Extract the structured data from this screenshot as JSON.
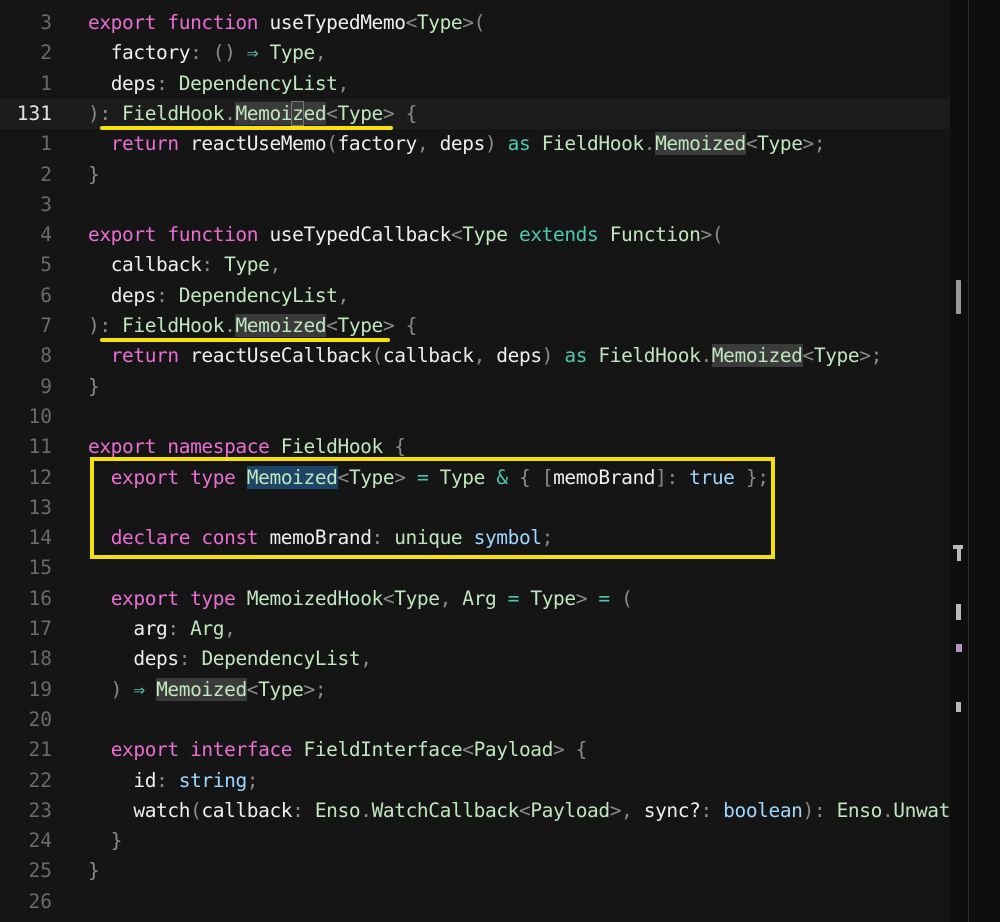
{
  "editor": {
    "lines": [
      {
        "n": "3",
        "tokens": [
          [
            "k",
            "export"
          ],
          [
            "v",
            " "
          ],
          [
            "k",
            "function"
          ],
          [
            "v",
            " "
          ],
          [
            "f",
            "useTypedMemo"
          ],
          [
            "p",
            "<"
          ],
          [
            "t",
            "Type"
          ],
          [
            "p",
            ">("
          ]
        ]
      },
      {
        "n": "2",
        "tokens": [
          [
            "v",
            "  "
          ],
          [
            "v",
            "factory"
          ],
          [
            "p",
            ": () "
          ],
          [
            "b",
            "⇒"
          ],
          [
            "v",
            " "
          ],
          [
            "t",
            "Type"
          ],
          [
            "p",
            ","
          ]
        ]
      },
      {
        "n": "1",
        "tokens": [
          [
            "v",
            "  "
          ],
          [
            "v",
            "deps"
          ],
          [
            "p",
            ": "
          ],
          [
            "t",
            "DependencyList"
          ],
          [
            "p",
            ","
          ]
        ]
      },
      {
        "n": "131",
        "current": true,
        "tokens": [
          [
            "p",
            "): "
          ],
          [
            "t",
            "FieldHook"
          ],
          [
            "p",
            "."
          ],
          [
            "hl",
            "Memoi"
          ],
          [
            "cur",
            "z"
          ],
          [
            "hl",
            "ed"
          ],
          [
            "p",
            "<"
          ],
          [
            "t",
            "Type"
          ],
          [
            "p",
            "> {"
          ]
        ]
      },
      {
        "n": "1",
        "tokens": [
          [
            "v",
            "  "
          ],
          [
            "k",
            "return"
          ],
          [
            "v",
            " "
          ],
          [
            "f",
            "reactUseMemo"
          ],
          [
            "p",
            "("
          ],
          [
            "v",
            "factory"
          ],
          [
            "p",
            ", "
          ],
          [
            "v",
            "deps"
          ],
          [
            "p",
            ") "
          ],
          [
            "b",
            "as"
          ],
          [
            "v",
            " "
          ],
          [
            "t",
            "FieldHook"
          ],
          [
            "p",
            "."
          ],
          [
            "hl",
            "Memoized"
          ],
          [
            "p",
            "<"
          ],
          [
            "t",
            "Type"
          ],
          [
            "p",
            ">;"
          ]
        ]
      },
      {
        "n": "2",
        "tokens": [
          [
            "p",
            "}"
          ]
        ]
      },
      {
        "n": "3",
        "tokens": []
      },
      {
        "n": "4",
        "tokens": [
          [
            "k",
            "export"
          ],
          [
            "v",
            " "
          ],
          [
            "k",
            "function"
          ],
          [
            "v",
            " "
          ],
          [
            "f",
            "useTypedCallback"
          ],
          [
            "p",
            "<"
          ],
          [
            "t",
            "Type"
          ],
          [
            "v",
            " "
          ],
          [
            "b",
            "extends"
          ],
          [
            "v",
            " "
          ],
          [
            "t",
            "Function"
          ],
          [
            "p",
            ">("
          ]
        ]
      },
      {
        "n": "5",
        "tokens": [
          [
            "v",
            "  "
          ],
          [
            "v",
            "callback"
          ],
          [
            "p",
            ": "
          ],
          [
            "t",
            "Type"
          ],
          [
            "p",
            ","
          ]
        ]
      },
      {
        "n": "6",
        "tokens": [
          [
            "v",
            "  "
          ],
          [
            "v",
            "deps"
          ],
          [
            "p",
            ": "
          ],
          [
            "t",
            "DependencyList"
          ],
          [
            "p",
            ","
          ]
        ]
      },
      {
        "n": "7",
        "tokens": [
          [
            "p",
            "): "
          ],
          [
            "t",
            "FieldHook"
          ],
          [
            "p",
            "."
          ],
          [
            "hl",
            "Memoized"
          ],
          [
            "p",
            "<"
          ],
          [
            "t",
            "Type"
          ],
          [
            "p",
            "> {"
          ]
        ]
      },
      {
        "n": "8",
        "tokens": [
          [
            "v",
            "  "
          ],
          [
            "k",
            "return"
          ],
          [
            "v",
            " "
          ],
          [
            "f",
            "reactUseCallback"
          ],
          [
            "p",
            "("
          ],
          [
            "v",
            "callback"
          ],
          [
            "p",
            ", "
          ],
          [
            "v",
            "deps"
          ],
          [
            "p",
            ") "
          ],
          [
            "b",
            "as"
          ],
          [
            "v",
            " "
          ],
          [
            "t",
            "FieldHook"
          ],
          [
            "p",
            "."
          ],
          [
            "hl",
            "Memoized"
          ],
          [
            "p",
            "<"
          ],
          [
            "t",
            "Type"
          ],
          [
            "p",
            ">;"
          ]
        ]
      },
      {
        "n": "9",
        "tokens": [
          [
            "p",
            "}"
          ]
        ]
      },
      {
        "n": "10",
        "tokens": []
      },
      {
        "n": "11",
        "tokens": [
          [
            "k",
            "export"
          ],
          [
            "v",
            " "
          ],
          [
            "k",
            "namespace"
          ],
          [
            "v",
            " "
          ],
          [
            "t",
            "FieldHook"
          ],
          [
            "p",
            " {"
          ]
        ]
      },
      {
        "n": "12",
        "tokens": [
          [
            "v",
            "  "
          ],
          [
            "k",
            "export"
          ],
          [
            "v",
            " "
          ],
          [
            "k",
            "type"
          ],
          [
            "v",
            " "
          ],
          [
            "hl2",
            "Memoized"
          ],
          [
            "p",
            "<"
          ],
          [
            "t",
            "Type"
          ],
          [
            "p",
            "> "
          ],
          [
            "b",
            "="
          ],
          [
            "v",
            " "
          ],
          [
            "t",
            "Type"
          ],
          [
            "v",
            " "
          ],
          [
            "b",
            "&"
          ],
          [
            "p",
            " { ["
          ],
          [
            "v",
            "memoBrand"
          ],
          [
            "p",
            "]: "
          ],
          [
            "c",
            "true"
          ],
          [
            "p",
            " };"
          ]
        ]
      },
      {
        "n": "13",
        "tokens": []
      },
      {
        "n": "14",
        "tokens": [
          [
            "v",
            "  "
          ],
          [
            "k",
            "declare"
          ],
          [
            "v",
            " "
          ],
          [
            "k",
            "const"
          ],
          [
            "v",
            " "
          ],
          [
            "v",
            "memoBrand"
          ],
          [
            "p",
            ": "
          ],
          [
            "t",
            "unique"
          ],
          [
            "v",
            " "
          ],
          [
            "c",
            "symbol"
          ],
          [
            "p",
            ";"
          ]
        ]
      },
      {
        "n": "15",
        "tokens": []
      },
      {
        "n": "16",
        "tokens": [
          [
            "v",
            "  "
          ],
          [
            "k",
            "export"
          ],
          [
            "v",
            " "
          ],
          [
            "k",
            "type"
          ],
          [
            "v",
            " "
          ],
          [
            "t",
            "MemoizedHook"
          ],
          [
            "p",
            "<"
          ],
          [
            "t",
            "Type"
          ],
          [
            "p",
            ", "
          ],
          [
            "t",
            "Arg"
          ],
          [
            "v",
            " "
          ],
          [
            "b",
            "="
          ],
          [
            "v",
            " "
          ],
          [
            "t",
            "Type"
          ],
          [
            "p",
            "> "
          ],
          [
            "b",
            "="
          ],
          [
            "p",
            " ("
          ]
        ]
      },
      {
        "n": "17",
        "tokens": [
          [
            "v",
            "    "
          ],
          [
            "v",
            "arg"
          ],
          [
            "p",
            ": "
          ],
          [
            "t",
            "Arg"
          ],
          [
            "p",
            ","
          ]
        ]
      },
      {
        "n": "18",
        "tokens": [
          [
            "v",
            "    "
          ],
          [
            "v",
            "deps"
          ],
          [
            "p",
            ": "
          ],
          [
            "t",
            "DependencyList"
          ],
          [
            "p",
            ","
          ]
        ]
      },
      {
        "n": "19",
        "tokens": [
          [
            "p",
            "  ) "
          ],
          [
            "b",
            "⇒"
          ],
          [
            "v",
            " "
          ],
          [
            "hl",
            "Memoized"
          ],
          [
            "p",
            "<"
          ],
          [
            "t",
            "Type"
          ],
          [
            "p",
            ">;"
          ]
        ]
      },
      {
        "n": "20",
        "tokens": []
      },
      {
        "n": "21",
        "tokens": [
          [
            "v",
            "  "
          ],
          [
            "k",
            "export"
          ],
          [
            "v",
            " "
          ],
          [
            "k",
            "interface"
          ],
          [
            "v",
            " "
          ],
          [
            "t",
            "FieldInterface"
          ],
          [
            "p",
            "<"
          ],
          [
            "t",
            "Payload"
          ],
          [
            "p",
            "> {"
          ]
        ]
      },
      {
        "n": "22",
        "tokens": [
          [
            "v",
            "    "
          ],
          [
            "v",
            "id"
          ],
          [
            "p",
            ": "
          ],
          [
            "c",
            "string"
          ],
          [
            "p",
            ";"
          ]
        ]
      },
      {
        "n": "23",
        "tokens": [
          [
            "v",
            "    "
          ],
          [
            "f",
            "watch"
          ],
          [
            "p",
            "("
          ],
          [
            "v",
            "callback"
          ],
          [
            "p",
            ": "
          ],
          [
            "t",
            "Enso"
          ],
          [
            "p",
            "."
          ],
          [
            "t",
            "WatchCallback"
          ],
          [
            "p",
            "<"
          ],
          [
            "t",
            "Payload"
          ],
          [
            "p",
            ">, "
          ],
          [
            "v",
            "sync?"
          ],
          [
            "p",
            ": "
          ],
          [
            "c",
            "boolean"
          ],
          [
            "p",
            "): "
          ],
          [
            "t",
            "Enso"
          ],
          [
            "p",
            "."
          ],
          [
            "t",
            "Unwatch"
          ]
        ]
      },
      {
        "n": "24",
        "tokens": [
          [
            "p",
            "  }"
          ]
        ]
      },
      {
        "n": "25",
        "tokens": [
          [
            "p",
            "}"
          ]
        ]
      },
      {
        "n": "26",
        "tokens": []
      }
    ]
  },
  "colors": {
    "annotation": "#f7df0a",
    "keyword": "#e96ed2",
    "type": "#bfe7be",
    "operator": "#4fc7ad"
  }
}
